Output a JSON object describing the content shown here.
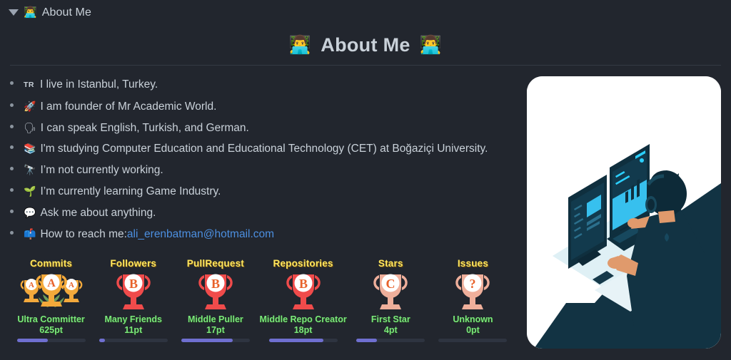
{
  "section_header": {
    "disclosure": "expanded",
    "emoji": "technologist-emoji",
    "title": "About Me"
  },
  "page_title": {
    "text": "About Me",
    "left_emoji": "technologist-emoji",
    "right_emoji": "technologist-emoji"
  },
  "facts": [
    {
      "icon": "flag-tr",
      "icon_text": "TR",
      "text": "I live in Istanbul, Turkey."
    },
    {
      "icon": "rocket-icon",
      "icon_text": "🚀",
      "text": "I am founder of Mr Academic World."
    },
    {
      "icon": "speaking-head-icon",
      "icon_text": "🗣",
      "text": "I can speak English, Turkish, and German."
    },
    {
      "icon": "books-icon",
      "icon_text": "📚",
      "text": "I'm studying Computer Education and Educational Technology (CET) at Boğaziçi University."
    },
    {
      "icon": "telescope-icon",
      "icon_text": "🔭",
      "text": "I’m not currently working."
    },
    {
      "icon": "seedling-icon",
      "icon_text": "🌱",
      "text": "I’m currently learning Game Industry."
    },
    {
      "icon": "speech-balloon-icon",
      "icon_text": "💬",
      "text": "Ask me about anything."
    },
    {
      "icon": "mailbox-icon",
      "icon_text": "📫",
      "text": "How to reach me: ",
      "link_text": "ali_erenbatman@hotmail.com",
      "link_color": "#4c8fe0"
    }
  ],
  "illustration": {
    "name": "developer-at-desk-illustration",
    "alt": "Isometric illustration of a developer with headphones working at dual monitors"
  },
  "trophies": [
    {
      "title": "Commits",
      "grade": "A",
      "rank": "Ultra Committer",
      "points": "625pt",
      "progress": 45,
      "style": "secret-gold",
      "trophy_color": "#F5A council"
    },
    {
      "title": "Followers",
      "grade": "B",
      "rank": "Many Friends",
      "points": "11pt",
      "progress": 9,
      "style": "red"
    },
    {
      "title": "PullRequest",
      "grade": "B",
      "rank": "Middle Puller",
      "points": "17pt",
      "progress": 75,
      "style": "red"
    },
    {
      "title": "Repositories",
      "grade": "B",
      "rank": "Middle Repo Creator",
      "points": "18pt",
      "progress": 80,
      "style": "red"
    },
    {
      "title": "Stars",
      "grade": "C",
      "rank": "First Star",
      "points": "4pt",
      "progress": 30,
      "style": "peach"
    },
    {
      "title": "Issues",
      "grade": "?",
      "rank": "Unknown",
      "points": "0pt",
      "progress": 0,
      "style": "peach"
    }
  ],
  "colors": {
    "background": "#22262e",
    "text": "#c9d1d9",
    "link": "#4c8fe0",
    "trophy_title": "#FFE75E",
    "trophy_rank": "#7BE87B",
    "progress_fill": "#6f6fd0",
    "progress_track": "#2e3440",
    "divider": "#343a44"
  }
}
